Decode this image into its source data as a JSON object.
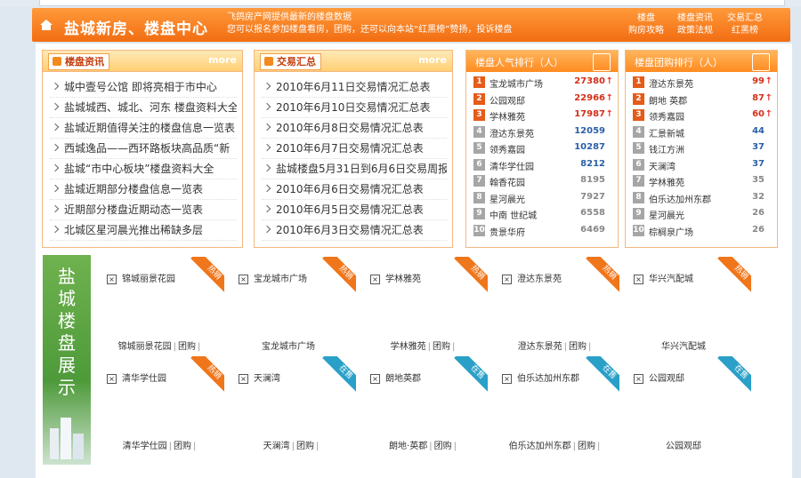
{
  "header": {
    "title": "盐城新房、楼盘中心",
    "desc_line1": "飞鸽房产网提供最新的楼盘数据",
    "desc_line2": "您可以报名参加楼盘看房，团购，还可以向本站“红黑榜”赞扬，投诉楼盘",
    "links": [
      "楼盘",
      "楼盘资讯",
      "交易汇总",
      "购房攻略",
      "政策法规",
      "红黑榜"
    ]
  },
  "news_panel": {
    "tag": "楼盘资讯",
    "more": "more",
    "items": [
      "城中壹号公馆 即将亮相于市中心",
      "盐城城西、城北、河东 楼盘资料大全",
      "盐城近期值得关注的楼盘信息一览表",
      "西城逸品——西环路板块高品质“新",
      "盐城“市中心板块”楼盘资料大全",
      "盐城近期部分楼盘信息一览表",
      "近期部分楼盘近期动态一览表",
      "北城区星河晨光推出稀缺多层"
    ]
  },
  "trade_panel": {
    "tag": "交易汇总",
    "more": "more",
    "items": [
      "2010年6月11日交易情况汇总表",
      "2010年6月10日交易情况汇总表",
      "2010年6月8日交易情况汇总表",
      "2010年6月7日交易情况汇总表",
      "盐城楼盘5月31日到6月6日交易周报",
      "2010年6月6日交易情况汇总表",
      "2010年6月5日交易情况汇总表",
      "2010年6月3日交易情况汇总表"
    ]
  },
  "popular_rank": {
    "title": "楼盘人气排行（人）",
    "rows": [
      {
        "n": "1",
        "name": "宝龙城市广场",
        "val": "27380",
        "up": "↑"
      },
      {
        "n": "2",
        "name": "公园观邸",
        "val": "22966",
        "up": "↑"
      },
      {
        "n": "3",
        "name": "学林雅苑",
        "val": "17987",
        "up": "↑"
      },
      {
        "n": "4",
        "name": "澄达东景苑",
        "val": "12059",
        "up": ""
      },
      {
        "n": "5",
        "name": "领秀嘉园",
        "val": "10287",
        "up": ""
      },
      {
        "n": "6",
        "name": "清华学仕园",
        "val": "8212",
        "up": ""
      },
      {
        "n": "7",
        "name": "翰香花园",
        "val": "8195",
        "up": ""
      },
      {
        "n": "8",
        "name": "星河晨光",
        "val": "7927",
        "up": ""
      },
      {
        "n": "9",
        "name": "中南 世纪城",
        "val": "6558",
        "up": ""
      },
      {
        "n": "10",
        "name": "贵景华府",
        "val": "6469",
        "up": ""
      }
    ]
  },
  "group_rank": {
    "title": "楼盘团购排行（人）",
    "rows": [
      {
        "n": "1",
        "name": "澄达东景苑",
        "val": "99",
        "up": "↑"
      },
      {
        "n": "2",
        "name": "朗地 英郡",
        "val": "87",
        "up": "↑"
      },
      {
        "n": "3",
        "name": "领秀嘉园",
        "val": "60",
        "up": "↑"
      },
      {
        "n": "4",
        "name": "汇景新城",
        "val": "44",
        "up": ""
      },
      {
        "n": "5",
        "name": "钱江方洲",
        "val": "37",
        "up": ""
      },
      {
        "n": "6",
        "name": "天澜湾",
        "val": "37",
        "up": ""
      },
      {
        "n": "7",
        "name": "学林雅苑",
        "val": "35",
        "up": ""
      },
      {
        "n": "8",
        "name": "伯乐达加州东郡",
        "val": "32",
        "up": ""
      },
      {
        "n": "9",
        "name": "星河晨光",
        "val": "26",
        "up": ""
      },
      {
        "n": "10",
        "name": "棕榈泉广场",
        "val": "26",
        "up": ""
      }
    ]
  },
  "showcase": {
    "side_title": "盐城楼盘展示",
    "cards": [
      {
        "img": "锦城丽景花园",
        "ribbon": "热销",
        "name": "锦城丽景花园",
        "sep1": "|",
        "link": "团购",
        "sep2": "|"
      },
      {
        "img": "宝龙城市广场",
        "ribbon": "热销",
        "name": "宝龙城市广场",
        "sep1": "",
        "link": "",
        "sep2": ""
      },
      {
        "img": "学林雅苑",
        "ribbon": "热销",
        "name": "学林雅苑",
        "sep1": "|",
        "link": "团购",
        "sep2": "|"
      },
      {
        "img": "澄达东景苑",
        "ribbon": "热销",
        "name": "澄达东景苑",
        "sep1": "|",
        "link": "团购",
        "sep2": "|"
      },
      {
        "img": "华兴汽配城",
        "ribbon": "热销",
        "name": "华兴汽配城",
        "sep1": "",
        "link": "",
        "sep2": ""
      },
      {
        "img": "清华学仕园",
        "ribbon": "热销",
        "name": "清华学仕园",
        "sep1": "|",
        "link": "团购",
        "sep2": "|"
      },
      {
        "img": "天澜湾",
        "ribbon": "在售",
        "name": "天澜湾",
        "sep1": "|",
        "link": "团购",
        "sep2": "|"
      },
      {
        "img": "朗地英郡",
        "ribbon": "在售",
        "name": "朗地·英郡",
        "sep1": "|",
        "link": "团购",
        "sep2": "|"
      },
      {
        "img": "伯乐达加州东郡",
        "ribbon": "在售",
        "name": "伯乐达加州东郡",
        "sep1": "|",
        "link": "团购",
        "sep2": "|"
      },
      {
        "img": "公园观邸",
        "ribbon": "在售",
        "name": "公园观邸",
        "sep1": "",
        "link": "",
        "sep2": ""
      }
    ]
  },
  "colors": {
    "orange": "#f27a1c",
    "hot": "#f0761b",
    "sale": "#2aa0c8",
    "rankTop": "#e55b19",
    "rankOther": "#a6a6a6",
    "valTop": "#d3301a",
    "valMid": "#2a5fa8",
    "valLow": "#888888"
  }
}
